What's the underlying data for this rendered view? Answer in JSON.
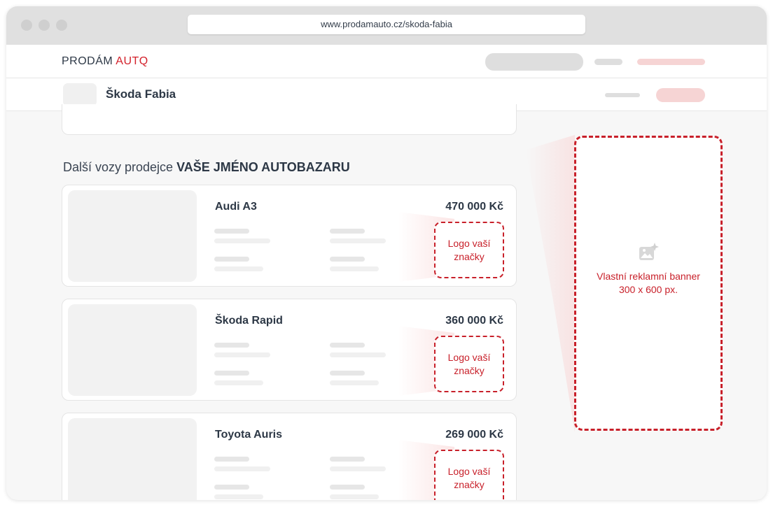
{
  "browser": {
    "url": "www.prodamauto.cz/skoda-fabia"
  },
  "site": {
    "logo_main": "PRODÁM ",
    "logo_accent": "AUTQ"
  },
  "subheader": {
    "title": "Škoda Fabia"
  },
  "section": {
    "title_prefix": "Další vozy prodejce ",
    "title_dealer": "VAŠE JMÉNO AUTOBAZARU"
  },
  "cars": [
    {
      "name": "Audi A3",
      "price": "470 000 Kč",
      "logo_line1": "Logo vaší",
      "logo_line2": "značky"
    },
    {
      "name": "Škoda Rapid",
      "price": "360 000 Kč",
      "logo_line1": "Logo vaší",
      "logo_line2": "značky"
    },
    {
      "name": "Toyota Auris",
      "price": "269 000 Kč",
      "logo_line1": "Logo vaší",
      "logo_line2": "značky"
    }
  ],
  "banner": {
    "line1": "Vlastní reklamní banner",
    "line2": "300 x 600 px.",
    "icon": "image-sparkle-icon"
  },
  "colors": {
    "accent": "#d3202a",
    "text": "#2d3846",
    "placeholder": "#e6e6e6",
    "accent_light": "#f8d7d7"
  }
}
